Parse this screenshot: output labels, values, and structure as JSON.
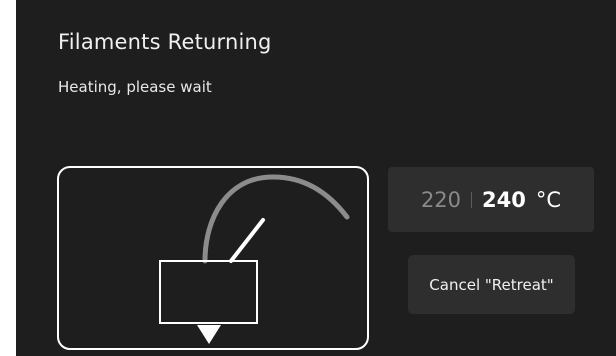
{
  "dialog": {
    "title": "Filaments Returning",
    "subtitle": "Heating, please wait"
  },
  "temperature": {
    "current": "220",
    "target": "240",
    "unit": "°C"
  },
  "actions": {
    "cancel_label": "Cancel \"Retreat\""
  },
  "illustration": {
    "icon": "nozzle-retract-icon"
  },
  "colors": {
    "background": "#1e1e1e",
    "panel": "#2e2e2e",
    "filament_tube": "#8c8c8c",
    "text": "#ffffff",
    "text_dim": "#8a8a8a"
  }
}
